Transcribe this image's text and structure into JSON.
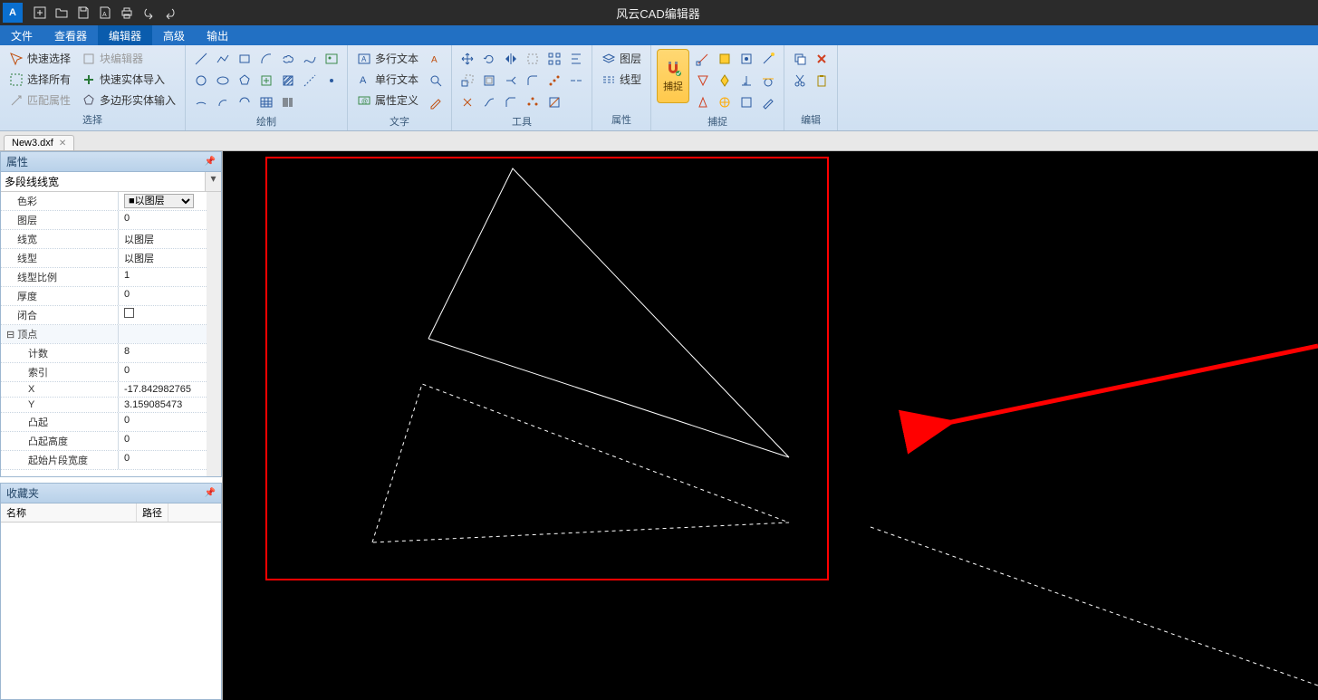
{
  "app": {
    "title": "风云CAD编辑器"
  },
  "menu": {
    "file": "文件",
    "viewer": "查看器",
    "editor": "编辑器",
    "advanced": "高级",
    "output": "输出"
  },
  "ribbon": {
    "select": {
      "quick_select": "快速选择",
      "select_all": "选择所有",
      "match_attr": "匹配属性",
      "block_editor": "块编辑器",
      "quick_entity_import": "快速实体导入",
      "polygon_entity_input": "多边形实体输入",
      "label": "选择"
    },
    "draw": {
      "label": "绘制"
    },
    "text": {
      "mtext": "多行文本",
      "stext": "单行文本",
      "attrdef": "属性定义",
      "label": "文字"
    },
    "tools": {
      "label": "工具"
    },
    "attr": {
      "layer": "图层",
      "linetype": "线型",
      "label": "属性"
    },
    "snap": {
      "capture": "捕捉",
      "label": "捕捉"
    },
    "edit": {
      "label": "编辑"
    }
  },
  "tabs": {
    "file1": "New3.dxf"
  },
  "props": {
    "title": "属性",
    "selector": "多段线线宽",
    "rows": {
      "color": {
        "k": "色彩",
        "v": "以图层"
      },
      "layer": {
        "k": "图层",
        "v": "0"
      },
      "lineweight": {
        "k": "线宽",
        "v": "以图层"
      },
      "linetype": {
        "k": "线型",
        "v": "以图层"
      },
      "ltscale": {
        "k": "线型比例",
        "v": "1"
      },
      "thickness": {
        "k": "厚度",
        "v": "0"
      },
      "closed": {
        "k": "闭合",
        "v": ""
      },
      "vertex": {
        "k": "顶点",
        "v": ""
      },
      "count": {
        "k": "计数",
        "v": "8"
      },
      "index": {
        "k": "索引",
        "v": "0"
      },
      "x": {
        "k": "X",
        "v": "-17.842982765"
      },
      "y": {
        "k": "Y",
        "v": "3.159085473"
      },
      "bulge": {
        "k": "凸起",
        "v": "0"
      },
      "bulge_h": {
        "k": "凸起高度",
        "v": "0"
      },
      "start_w": {
        "k": "起始片段宽度",
        "v": "0"
      }
    }
  },
  "fav": {
    "title": "收藏夹",
    "col_name": "名称",
    "col_path": "路径"
  }
}
